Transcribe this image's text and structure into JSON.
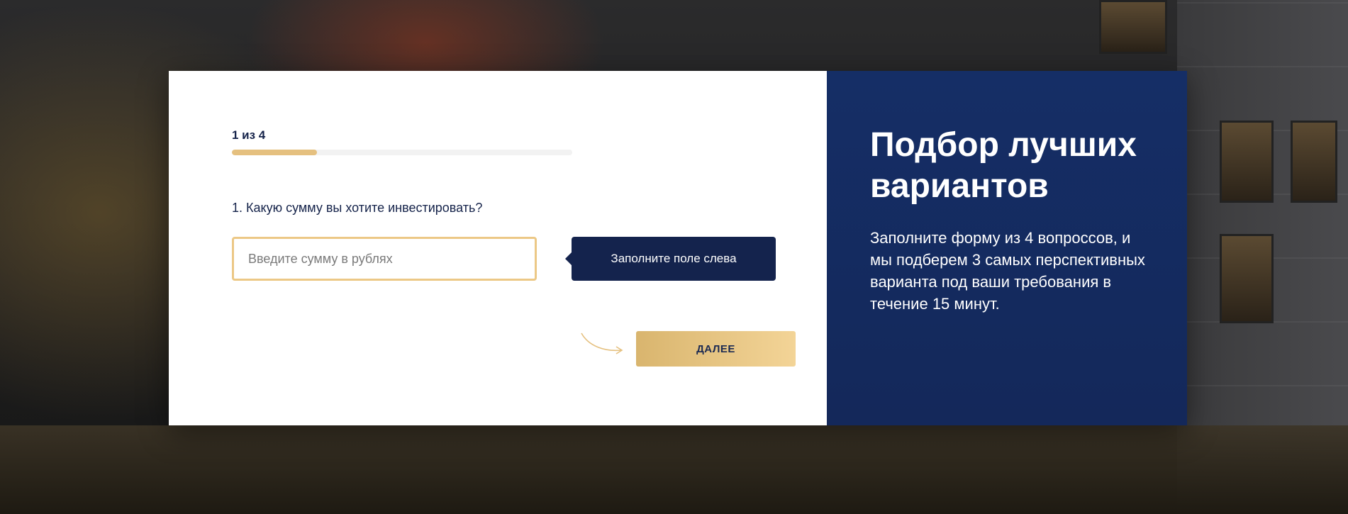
{
  "form": {
    "step_label": "1 из 4",
    "progress": 0.25,
    "question": "1. Какую сумму вы хотите инвестировать?",
    "amount_placeholder": "Введите сумму в рублях",
    "amount_value": "",
    "hint": "Заполните поле слева",
    "next_label": "ДАЛЕЕ"
  },
  "info": {
    "title": "Подбор лучших вариантов",
    "text": "Заполните форму из 4 вопроссов, и мы подберем 3 самых перспективных варианта под ваши требования в течение 15 минут."
  },
  "colors": {
    "accent_gold": "#e5c07f",
    "navy": "#14234d",
    "panel_blue": "#152e66"
  },
  "icons": {
    "arrow": "curved-arrow-right-icon"
  }
}
